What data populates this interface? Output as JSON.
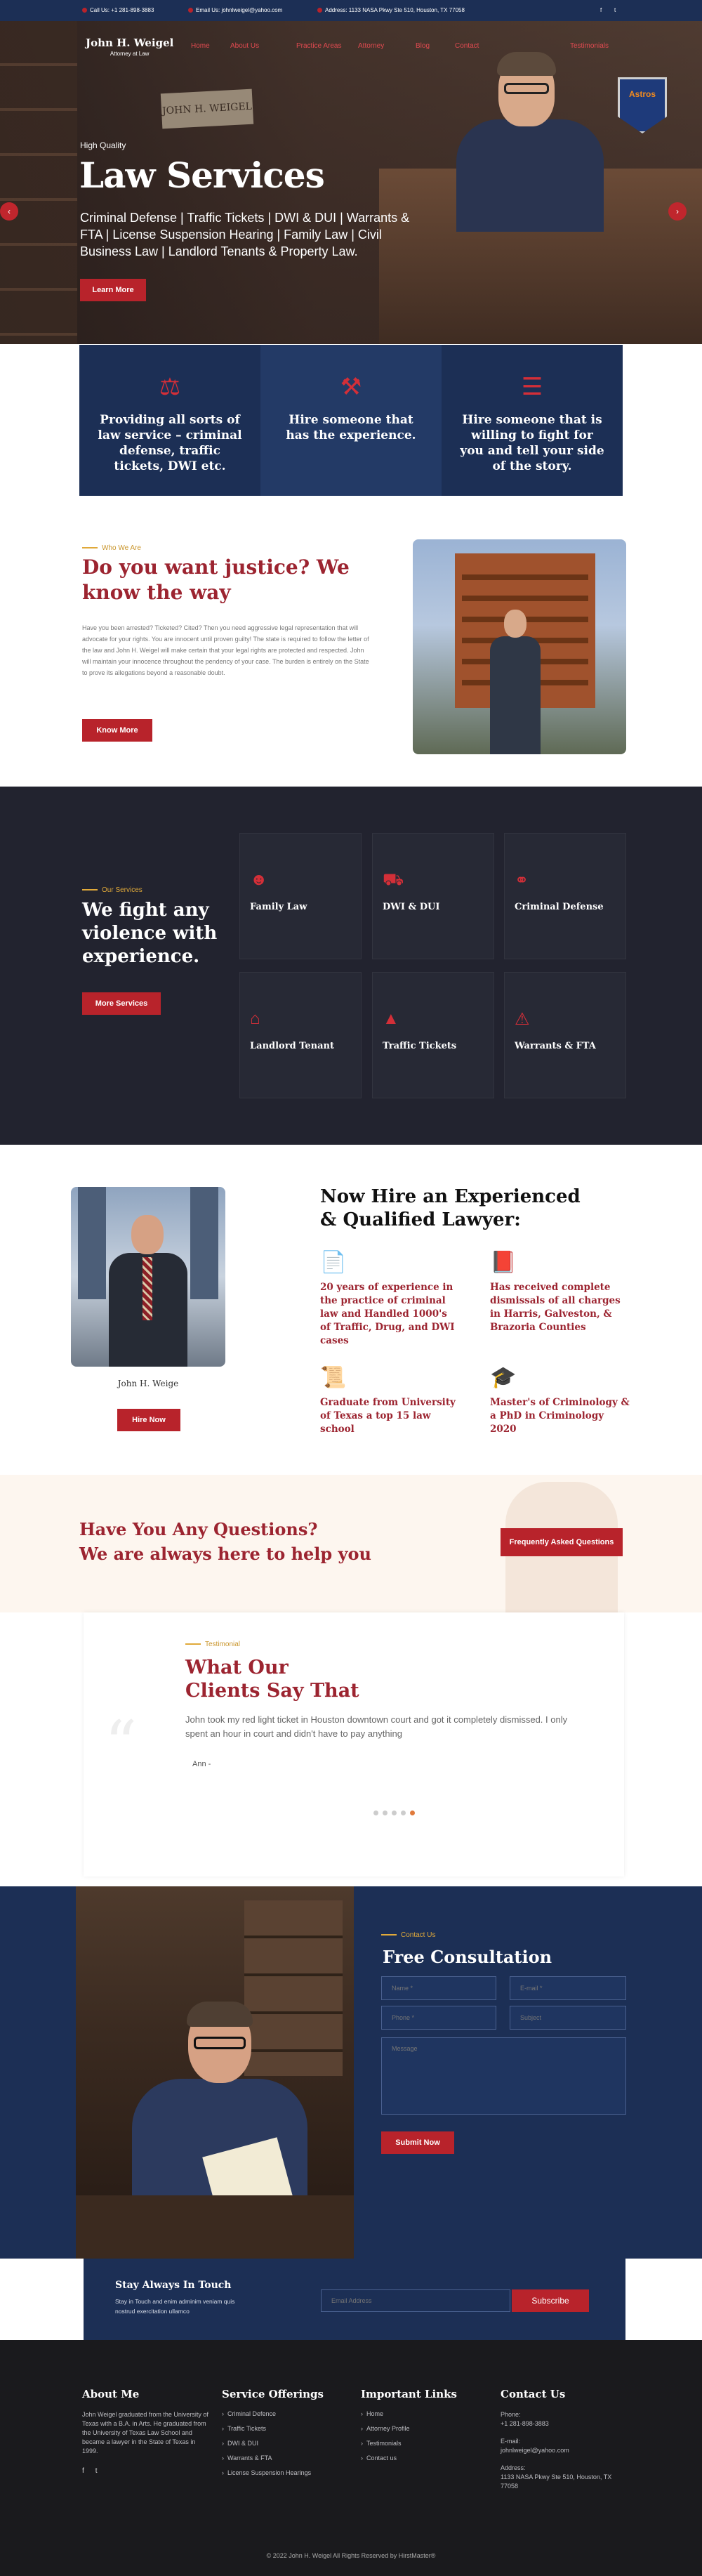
{
  "topbar": {
    "phone": "Call Us: +1 281-898-3883",
    "email": "Email Us: johnlweigel@yahoo.com",
    "address": "Address: 1133 NASA Pkwy Ste 510, Houston, TX 77058",
    "social": [
      "f",
      "t"
    ]
  },
  "brand": {
    "name": "John H. Weigel",
    "tagline": "Attorney at Law"
  },
  "nav": [
    "Home",
    "About Us",
    "Practice Areas",
    "Attorney",
    "Blog",
    "Contact",
    "Testimonials"
  ],
  "hero": {
    "kicker": "High Quality",
    "title": "Law Services",
    "description": "Criminal Defense | Traffic Tickets | DWI & DUI | Warrants & FTA | License Suspension Hearing | Family Law | Civil Business Law | Landlord Tenants & Property Law.",
    "button": "Learn More",
    "prev": "‹",
    "next": "›",
    "plaque": "JOHN H. WEIGEL",
    "pennant": "Astros"
  },
  "features": [
    {
      "icon": "briefcase-icon",
      "text": "Providing all sorts of law service – criminal defense, traffic tickets, DWI etc."
    },
    {
      "icon": "gavel-icon",
      "text": "Hire someone that has the experience."
    },
    {
      "icon": "books-icon",
      "text": "Hire someone that is willing to fight for you and tell your side of the story."
    }
  ],
  "about": {
    "kicker": "Who We Are",
    "title": "Do you want justice? We know the way",
    "paragraph": "Have you been arrested? Ticketed? Cited? Then you need aggressive legal representation that will advocate for your rights. You are innocent until proven guilty! The state is required to follow the letter of the law and John H. Weigel will make certain that your legal rights are protected and respected. John will maintain your innocence throughout the pendency of your case. The burden is entirely on the State to prove its allegations beyond a reasonable doubt.",
    "button": "Know More"
  },
  "services": {
    "kicker": "Our Services",
    "title": "We fight any violence with experience.",
    "button": "More Services",
    "items": [
      {
        "label": "Family Law",
        "icon": "family-icon"
      },
      {
        "label": "DWI & DUI",
        "icon": "car-icon"
      },
      {
        "label": "Criminal Defense",
        "icon": "handcuffs-icon"
      },
      {
        "label": "Landlord Tenant",
        "icon": "tenant-icon"
      },
      {
        "label": "Traffic Tickets",
        "icon": "traffic-cone-icon"
      },
      {
        "label": "Warrants & FTA",
        "icon": "warrant-icon"
      }
    ]
  },
  "hire": {
    "name": "John H. Weige",
    "button": "Hire Now",
    "title": "Now Hire an Experienced & Qualified Lawyer:",
    "items": [
      {
        "icon": "document-icon",
        "text": "20 years of experience in the practice of criminal law and Handled 1000's of Traffic, Drug, and DWI cases"
      },
      {
        "icon": "law-book-icon",
        "text": "Has received complete dismissals of all charges in Harris, Galveston, & Brazoria Counties"
      },
      {
        "icon": "certificate-icon",
        "text": "Graduate from University of Texas a top 15 law school"
      },
      {
        "icon": "graduate-icon",
        "text": "Master's of Criminology & a PhD in Criminology 2020"
      }
    ]
  },
  "questions": {
    "line1": "Have You Any Questions?",
    "line2": "We are always here to help you",
    "button": "Frequently Asked Questions"
  },
  "testimonial": {
    "kicker": "Testimonial",
    "title": "What Our Clients Say That",
    "quote": "John took my red light ticket in Houston downtown court and got it completely dismissed. I only spent an hour in court and didn't have to pay anything",
    "author": "Ann -",
    "quote_mark": "“",
    "dots": 5,
    "active_dot": 4
  },
  "consultation": {
    "kicker": "Contact Us",
    "title": "Free Consultation",
    "name_placeholder": "Name *",
    "email_placeholder": "E-mail *",
    "phone_placeholder": "Phone *",
    "subject_placeholder": "Subject",
    "message_placeholder": "Message",
    "button": "Submit Now"
  },
  "newsletter": {
    "title": "Stay Always In Touch",
    "description": "Stay in Touch and enim adminim veniam quis nostrud exercitation ullamco",
    "placeholder": "Email Address",
    "button": "Subscribe"
  },
  "footer": {
    "about_title": "About Me",
    "about_text": "John Weigel graduated from the University of Texas with a B.A. in Arts. He graduated from the University of Texas Law School and became a lawyer in the State of Texas in 1999.",
    "social": [
      "f",
      "t"
    ],
    "services_title": "Service Offerings",
    "services": [
      "Criminal Defence",
      "Traffic Tickets",
      "DWI & DUI",
      "Warrants & FTA",
      "License Suspension Hearings"
    ],
    "links_title": "Important Links",
    "links": [
      "Home",
      "Attorney Profile",
      "Testimonials",
      "Contact us"
    ],
    "contact_title": "Contact Us",
    "phone_label": "Phone:",
    "phone": "+1 281-898-3883",
    "email_label": "E-mail:",
    "email": "johnlweigel@yahoo.com",
    "address_label": "Address:",
    "address": "1133 NASA Pkwy Ste 510, Houston, TX 77058",
    "copyright": "© 2022 John H. Weigel All Rights Reserved by HirstMaster®"
  },
  "colors": {
    "brand_red": "#b8232b",
    "navy": "#1c2f55",
    "dark": "#22232f",
    "gold": "#e0a93a"
  }
}
